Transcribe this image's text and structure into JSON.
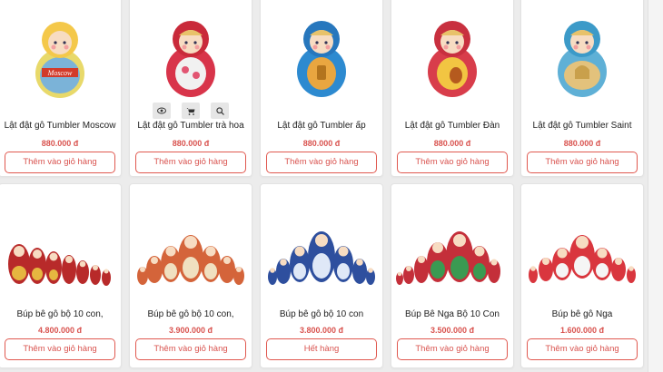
{
  "products_row1": [
    {
      "name": "Lật đật gỗ Tumbler Moscow",
      "price": "880.000 đ",
      "button": "Thêm vào giỏ hàng"
    },
    {
      "name": "Lật đật gỗ Tumbler trà hoa",
      "price": "880.000 đ",
      "button": "Thêm vào giỏ hàng"
    },
    {
      "name": "Lật đật gỗ Tumbler ấp",
      "price": "880.000 đ",
      "button": "Thêm vào giỏ hàng"
    },
    {
      "name": "Lật đật gỗ Tumbler Đàn",
      "price": "880.000 đ",
      "button": "Thêm vào giỏ hàng"
    },
    {
      "name": "Lật đật gỗ Tumbler Saint",
      "price": "880.000 đ",
      "button": "Thêm vào giỏ hàng"
    }
  ],
  "products_row2": [
    {
      "name": "Búp bê gỗ bộ 10 con,",
      "price": "4.800.000 đ",
      "button": "Thêm vào giỏ hàng"
    },
    {
      "name": "Búp bê gỗ bộ 10 con,",
      "price": "3.900.000 đ",
      "button": "Thêm vào giỏ hàng"
    },
    {
      "name": "Búp bê gỗ bộ 10 con",
      "price": "3.800.000 đ",
      "button": "Hết hàng"
    },
    {
      "name": "Búp Bê Nga Bộ 10 Con",
      "price": "3.500.000 đ",
      "button": "Thêm vào giỏ hàng"
    },
    {
      "name": "Búp bê gỗ Nga",
      "price": "1.600.000 đ",
      "button": "Thêm vào giỏ hàng"
    }
  ],
  "hover_actions": {
    "icons": [
      "eye-icon",
      "cart-icon",
      "search-icon"
    ]
  },
  "colors": {
    "accent": "#d9534f",
    "button_border": "#e0584f"
  }
}
